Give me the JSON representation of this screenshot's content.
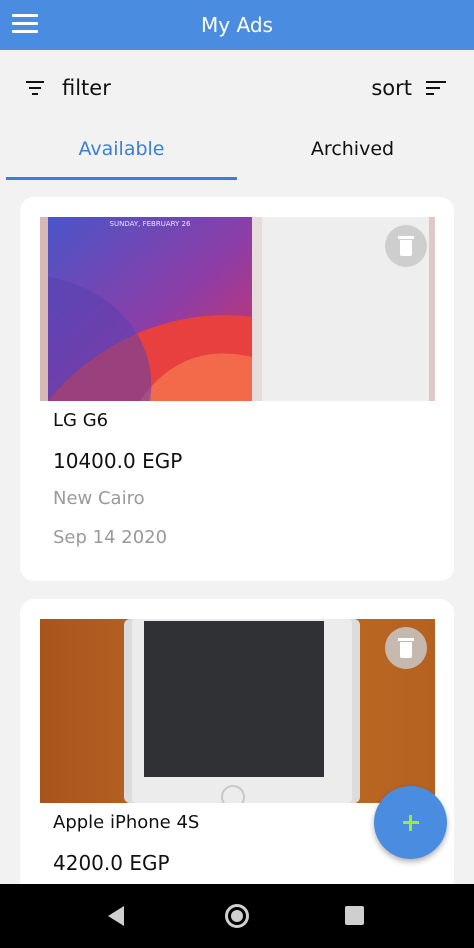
{
  "app_bar": {
    "title": "My Ads",
    "color": "#4a8ce0"
  },
  "toolbar": {
    "filter_label": "filter",
    "sort_label": "sort"
  },
  "tabs": [
    {
      "label": "Available",
      "active": true
    },
    {
      "label": "Archived",
      "active": false
    }
  ],
  "ads": [
    {
      "title": "LG G6",
      "price": "10400.0 EGP",
      "location": "New Cairo",
      "date": "Sep 14 2020",
      "photo_text": "SUNDAY, FEBRUARY 26"
    },
    {
      "title": "Apple iPhone 4S",
      "price": "4200.0 EGP"
    }
  ],
  "fab": {
    "icon": "plus-icon"
  },
  "accent_color": "#3a7fd5"
}
